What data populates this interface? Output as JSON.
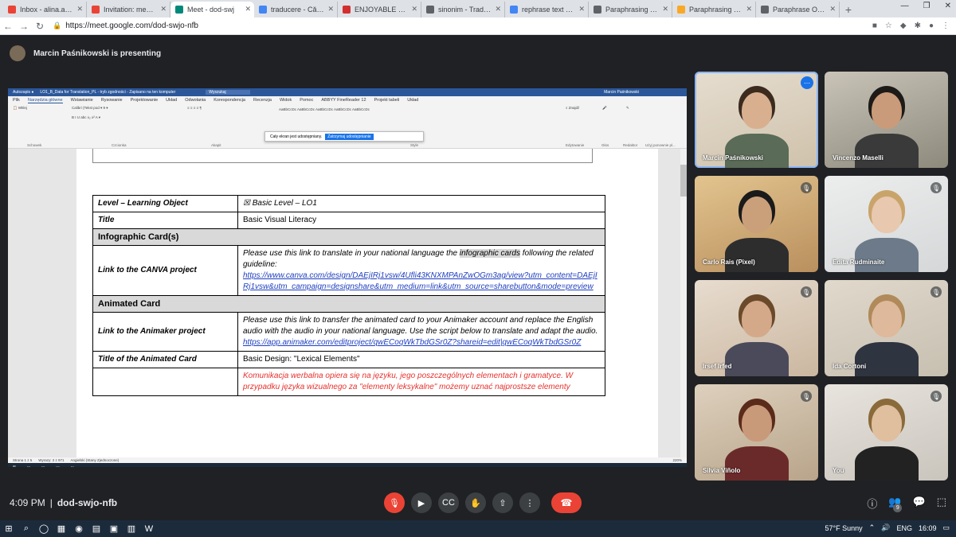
{
  "browser": {
    "tabs": [
      {
        "title": "Inbox - alina.ailinca",
        "color": "#ea4335"
      },
      {
        "title": "Invitation: meeting",
        "color": "#ea4335"
      },
      {
        "title": "Meet - dod-swj",
        "color": "#00897b",
        "active": true
      },
      {
        "title": "traducere - Căutare",
        "color": "#4285f4"
      },
      {
        "title": "ENJOYABLE Synony",
        "color": "#d32f2f"
      },
      {
        "title": "sinonim - Traducere",
        "color": "#5f6368"
      },
      {
        "title": "rephrase text - Căut",
        "color": "#4285f4"
      },
      {
        "title": "Paraphrasing Tool",
        "color": "#5f6368"
      },
      {
        "title": "Paraphrasing Tool",
        "color": "#f9a825"
      },
      {
        "title": "Paraphrase Online",
        "color": "#5f6368"
      }
    ],
    "url": "https://meet.google.com/dod-swjo-nfb"
  },
  "meeting": {
    "presenting_text": "Marcin Paśnikowski is presenting",
    "time": "4:09 PM",
    "code": "dod-swjo-nfb",
    "participant_count": "9",
    "participants": [
      {
        "name": "Marcin Paśnikowski",
        "muted": false,
        "speaking": true
      },
      {
        "name": "Vincenzo Maselli",
        "muted": false
      },
      {
        "name": "Carlo Rais (Pixel)",
        "muted": true
      },
      {
        "name": "Edita Rudminaite",
        "muted": true
      },
      {
        "name": "Irsef Irfed",
        "muted": true
      },
      {
        "name": "Ida Cortoni",
        "muted": true
      },
      {
        "name": "Silvia Viñolo",
        "muted": true
      },
      {
        "name": "You",
        "muted": true
      }
    ]
  },
  "word": {
    "title_bar": "LO1_B_Data for Translation_PL - tryb zgodności - Zapisano na ten komputer",
    "search": "Wyszukaj",
    "user": "Marcin Paśnikowski",
    "menu": [
      "Plik",
      "Narzędzia główne",
      "Wstawianie",
      "Rysowanie",
      "Projektowanie",
      "Układ",
      "Odwołania",
      "Korespondencja",
      "Recenzja",
      "Widok",
      "Pomoc",
      "ABBYY FineReader 12",
      "Projekt tabeli",
      "Układ"
    ],
    "ribbon_groups": [
      "Schowek",
      "Czcionka",
      "Akapit",
      "Style",
      "Edytowanie",
      "Głos",
      "Redaktor",
      "Użyj ponownie pl..."
    ],
    "share_banner": "Cały ekran jest udostępniany.",
    "share_stop": "Zatrzymaj udostępnianie",
    "status": {
      "page": "Strona 1 z 5",
      "words": "Wyrazy: 2 z 971",
      "lang": "Angielski (Stany Zjednoczone)",
      "zoom": "220%"
    },
    "table": {
      "level_label": "Level – Learning Object",
      "level_value": "☒ Basic Level – LO1",
      "title_label": "Title",
      "title_value": "Basic Visual Literacy",
      "sec1": "Infographic Card(s)",
      "canva_label": "Link to the CANVA project",
      "canva_text_a": "Please use this link to translate in your national language the ",
      "canva_text_hl": "infographic cards",
      "canva_text_b": " following the related guideline:",
      "canva_link": "https://www.canva.com/design/DAEjIRj1vsw/4Ufli43KNXMPAnZwOGm3ag/view?utm_content=DAEjIRj1vsw&utm_campaign=designshare&utm_medium=link&utm_source=sharebutton&mode=preview",
      "sec2": "Animated Card",
      "anim_label": "Link to the Animaker project",
      "anim_text": "Please use this link to transfer the animated card to your Animaker account and replace the English audio with the audio in your national language. Use the script below to translate and adapt the audio.",
      "anim_link": "https://app.animaker.com/editproject/qwECoqWkTbdGSr0Z?shareid=edit|qwECoqWkTbdGSr0Z",
      "animtitle_label": "Title of the Animated Card",
      "animtitle_value": "Basic Design: \"Lexical Elements\"",
      "polish_text": "Komunikacja werbalna opiera się na języku, jego poszczególnych elementach i gramatyce. W przypadku języka wizualnego za \"elementy leksykalne\" możemy uznać najprostsze elementy"
    }
  },
  "taskbar": {
    "weather": "57°F  Sunny",
    "lang": "ENG",
    "clock": "16:09"
  }
}
